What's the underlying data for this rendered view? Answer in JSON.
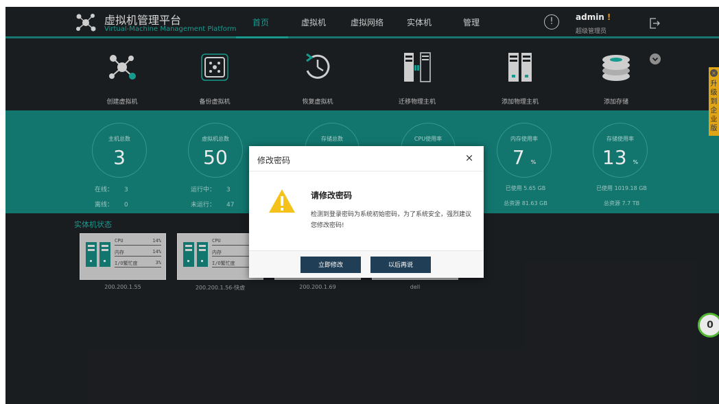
{
  "header": {
    "title": "虚拟机管理平台",
    "subtitle": "Virtual-Machine Management Platform",
    "nav": [
      "首页",
      "虚拟机",
      "虚拟网络",
      "实体机",
      "管理"
    ],
    "active_nav": "首页",
    "user": {
      "name": "admin",
      "mark": "!",
      "role": "超级管理员"
    }
  },
  "actions": [
    {
      "label": "创建虚拟机",
      "icon": "create-vm-icon"
    },
    {
      "label": "备份虚拟机",
      "icon": "backup-vm-icon"
    },
    {
      "label": "恢复虚拟机",
      "icon": "restore-vm-icon"
    },
    {
      "label": "迁移物理主机",
      "icon": "migrate-host-icon"
    },
    {
      "label": "添加物理主机",
      "icon": "add-host-icon"
    },
    {
      "label": "添加存储",
      "icon": "add-storage-icon"
    }
  ],
  "stats": {
    "hosts": {
      "title": "主机总数",
      "value": "3",
      "online_label": "在线：",
      "online": "3",
      "offline_label": "离线：",
      "offline": "0"
    },
    "vms": {
      "title": "虚拟机总数",
      "value": "50",
      "running_label": "运行中：",
      "running": "3",
      "stopped_label": "未运行：",
      "stopped": "47"
    },
    "storage": {
      "title": "存储总数"
    },
    "cpu": {
      "title": "CPU使用率"
    },
    "memory": {
      "title": "内存使用率",
      "value": "7",
      "unit": "%",
      "used": "已使用 5.65 GB",
      "total": "总资源 81.63 GB"
    },
    "disk": {
      "title": "存储使用率",
      "value": "13",
      "unit": "%",
      "used": "已使用 1019.18 GB",
      "total": "总资源 7.7 TB"
    }
  },
  "hosts_section": {
    "title": "实体机状态",
    "hosts": [
      {
        "ip": "200.200.1.55",
        "cpu_label": "CPU",
        "cpu": "14%",
        "mem_label": "内存",
        "mem": "14%",
        "io_label": "I/O繁忙度",
        "io": "3%"
      },
      {
        "ip": "200.200.1.56-快虚",
        "cpu_label": "CPU",
        "cpu": "",
        "mem_label": "内存",
        "mem": "",
        "io_label": "I/O繁忙度",
        "io": ""
      },
      {
        "ip": "200.200.1.69"
      },
      {
        "ip": "dell"
      }
    ]
  },
  "side": {
    "upgrade": "升级到企业版",
    "badge": "0"
  },
  "modal": {
    "title": "修改密码",
    "close": "×",
    "heading": "请修改密码",
    "body": "检测到登录密码为系统初始密码，为了系统安全，强烈建议您修改密码!",
    "primary": "立即修改",
    "secondary": "以后再说"
  },
  "colors": {
    "teal": "#148079",
    "accent": "#1aa89b",
    "dark": "#1d2023",
    "button": "#203e55",
    "warning": "#f5c21b"
  }
}
